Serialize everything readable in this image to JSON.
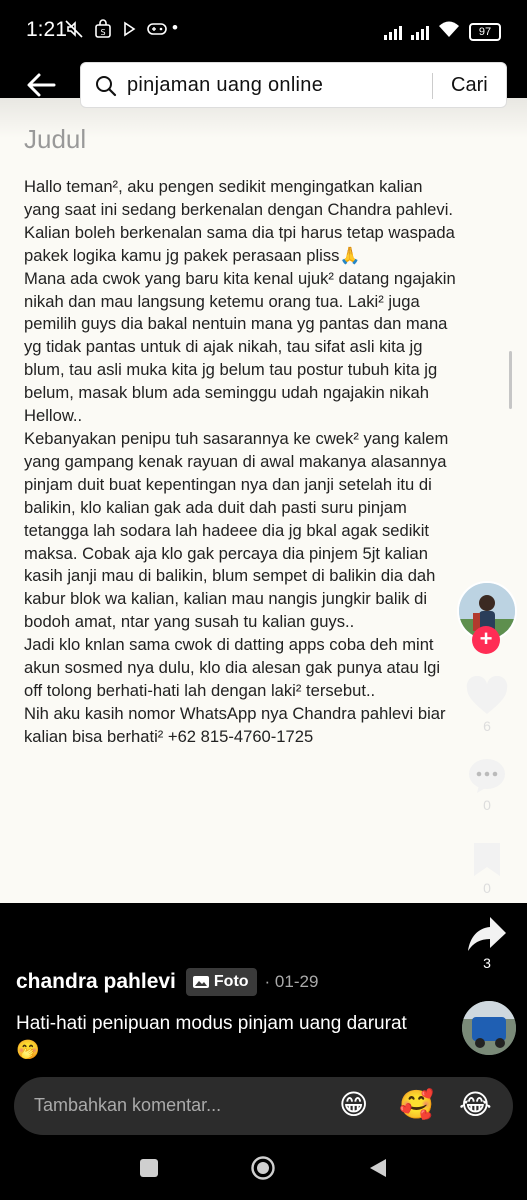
{
  "status_bar": {
    "time": "1:21",
    "battery": "97",
    "icons": [
      "mute-icon",
      "store-icon",
      "play-icon",
      "gamepad-icon"
    ]
  },
  "search": {
    "query": "pinjaman uang online",
    "submit_label": "Cari"
  },
  "note": {
    "title": "Judul",
    "body": "Hallo teman², aku pengen sedikit mengingatkan kalian\nyang saat ini sedang berkenalan dengan Chandra pahlevi.\nKalian boleh berkenalan sama dia tpi harus tetap waspada\npakek logika kamu jg pakek perasaan pliss🙏\nMana ada cwok yang baru kita kenal ujuk² datang ngajakin\nnikah dan mau langsung ketemu orang tua. Laki² juga\npemilih guys dia bakal nentuin mana yg pantas dan mana\nyg tidak pantas untuk di ajak nikah, tau sifat asli kita jg\nblum, tau asli muka kita jg belum tau postur tubuh kita jg\nbelum, masak blum ada seminggu udah ngajakin nikah\nHellow..\nKebanyakan penipu tuh sasarannya ke cwek² yang kalem\nyang gampang kenak rayuan di awal makanya alasannya\npinjam duit buat kepentingan nya dan janji setelah itu di\nbalikin, klo kalian gak ada duit dah pasti suru pinjam\ntetangga lah sodara lah hadeee dia jg bkal agak sedikit\nmaksa. Cobak aja klo gak percaya dia pinjem 5jt kalian\nkasih janji mau di balikin, blum sempet di balikin dia dah\nkabur blok wa kalian, kalian mau nangis jungkir balik di\nbodoh amat, ntar yang susah tu kalian guys..\nJadi klo knlan sama cwok di datting apps coba deh mint\nakun sosmed nya dulu, klo dia alesan gak punya atau lgi\noff tolong berhati-hati lah dengan laki² tersebut..\nNih aku kasih nomor WhatsApp nya Chandra pahlevi biar\nkalian bisa berhati² +62 815-4760-1725"
  },
  "actions": {
    "likes": "6",
    "comments": "0",
    "favorites": "0",
    "shares": "3"
  },
  "post": {
    "author": "chandra pahlevi",
    "type_label": "Foto",
    "date": "· 01-29",
    "caption": "Hati-hati penipuan modus pinjam uang darurat🤭"
  },
  "comment_bar": {
    "placeholder": "Tambahkan komentar...",
    "emojis": [
      "😁",
      "🥰",
      "😂"
    ]
  },
  "colors": {
    "follow_badge": "#ff2d55",
    "paper": "#fbfaf5",
    "comment_bar": "#2c2c2c"
  }
}
